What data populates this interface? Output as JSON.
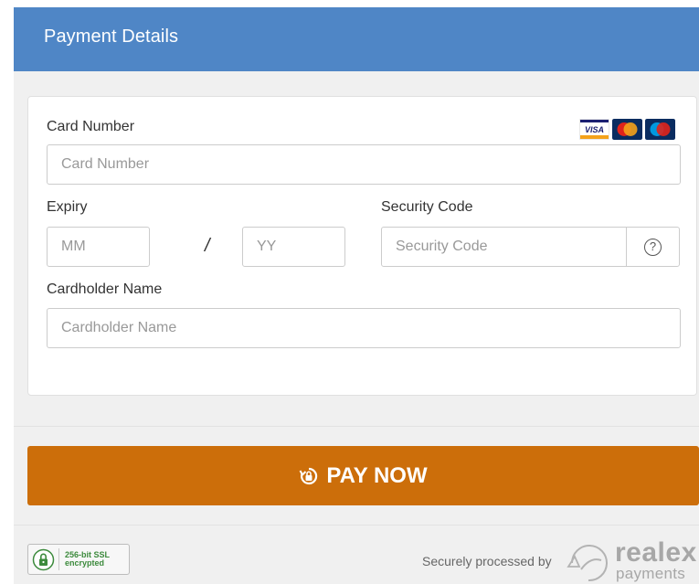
{
  "header": {
    "title": "Payment Details"
  },
  "form": {
    "card_number_label": "Card Number",
    "card_number_placeholder": "Card Number",
    "expiry_label": "Expiry",
    "month_placeholder": "MM",
    "expiry_separator": "/",
    "year_placeholder": "YY",
    "security_code_label": "Security Code",
    "security_code_placeholder": "Security Code",
    "help_symbol": "?",
    "cardholder_label": "Cardholder Name",
    "cardholder_placeholder": "Cardholder Name",
    "card_logos": [
      "visa",
      "mastercard",
      "maestro"
    ],
    "visa_text": "VISA"
  },
  "pay_button": {
    "label": "PAY NOW",
    "icon": "lock-refresh-icon"
  },
  "footer": {
    "ssl_line1": "256-bit SSL",
    "ssl_line2": "encrypted",
    "secure_text": "Securely processed by",
    "brand_name": "realex",
    "brand_sub": "payments"
  },
  "colors": {
    "header": "#4f86c6",
    "button": "#cc6e0a",
    "background": "#f0f0f0",
    "ssl_green": "#3c8a3c",
    "brand_gray": "#a7a7a7"
  }
}
